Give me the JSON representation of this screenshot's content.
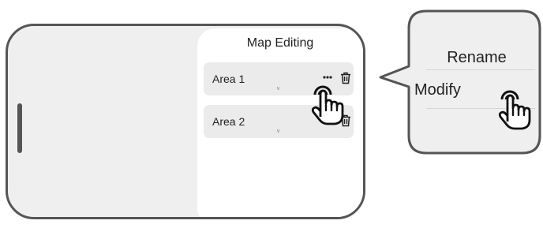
{
  "map_panel": {
    "title": "Map Editing",
    "areas": [
      {
        "label": "Area 1"
      },
      {
        "label": "Area 2"
      }
    ]
  },
  "context_menu": {
    "items": [
      {
        "label": "Rename"
      },
      {
        "label": "Modify"
      }
    ]
  },
  "icons": {
    "more": "more-horizontal-icon",
    "delete": "trash-icon",
    "expand": "chevron-down-icon",
    "pointer": "tap-hand-icon"
  },
  "colors": {
    "device_frame": "#555555",
    "screen_bg": "#efefef",
    "panel_bg": "#ffffff",
    "row_bg": "#ebebeb",
    "bubble_bg": "#efefef"
  }
}
